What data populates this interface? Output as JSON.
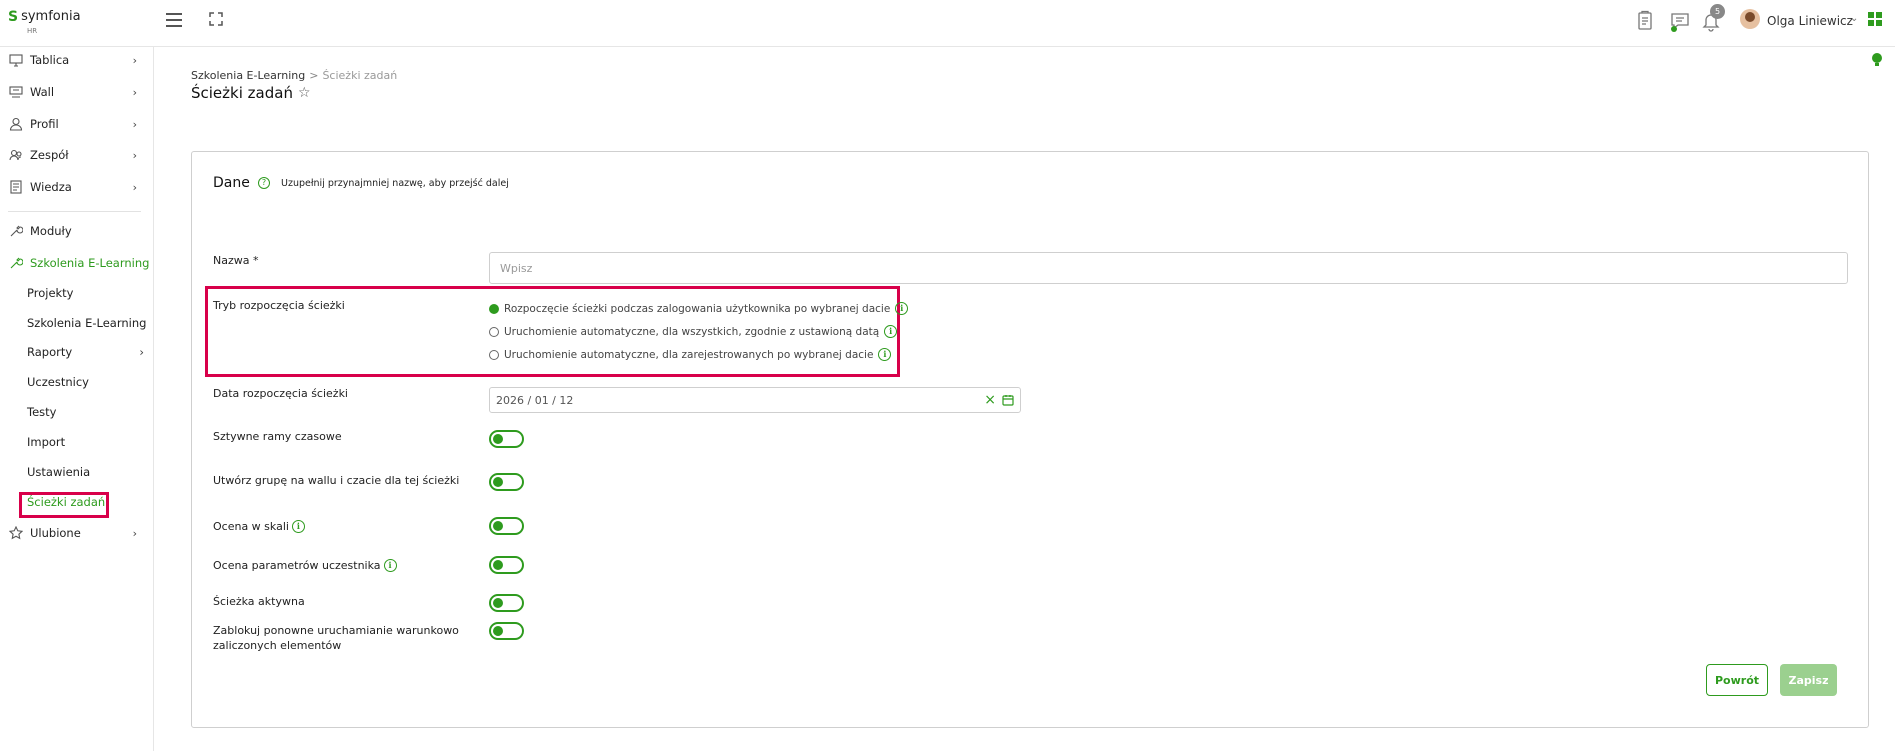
{
  "app": {
    "logo_text": "symfonia",
    "logo_sub": "HR",
    "notifications_count": "5",
    "user_name": "Olga Liniewicz"
  },
  "sidebar": {
    "items": [
      {
        "label": "Tablica",
        "icon": "monitor-icon"
      },
      {
        "label": "Wall",
        "icon": "wall-icon"
      },
      {
        "label": "Profil",
        "icon": "user-icon"
      },
      {
        "label": "Zespół",
        "icon": "team-icon"
      },
      {
        "label": "Wiedza",
        "icon": "book-icon"
      },
      {
        "label": "Moduły",
        "icon": "wrench-icon"
      },
      {
        "label": "Szkolenia E-Learning",
        "icon": "wrench-icon"
      }
    ],
    "sub_items": [
      "Projekty",
      "Szkolenia E-Learning",
      "Raporty",
      "Uczestnicy",
      "Testy",
      "Import",
      "Ustawienia",
      "Ścieżki zadań"
    ],
    "favorites": "Ulubione"
  },
  "header": {
    "breadcrumb_parent": "Szkolenia E-Learning",
    "breadcrumb_sep": ">",
    "breadcrumb_current": "Ścieżki zadań",
    "title": "Ścieżki zadań"
  },
  "form": {
    "section_title": "Dane",
    "hint": "Uzupełnij przynajmniej nazwę, aby przejść dalej",
    "name_label": "Nazwa *",
    "name_placeholder": "Wpisz",
    "mode_label": "Tryb rozpoczęcia ścieżki",
    "mode_options": [
      "Rozpoczęcie ścieżki podczas zalogowania użytkownika po wybranej dacie",
      "Uruchomienie automatyczne, dla wszystkich, zgodnie z ustawioną datą",
      "Uruchomienie automatyczne, dla zarejestrowanych po wybranej dacie"
    ],
    "mode_selected": 0,
    "start_date_label": "Data rozpoczęcia ścieżki",
    "start_date_value": "2026 / 01 / 12",
    "toggles": [
      {
        "label": "Sztywne ramy czasowe",
        "on": true
      },
      {
        "label": "Utwórz grupę na wallu i czacie dla tej ścieżki",
        "on": true
      },
      {
        "label": "Ocena w skali",
        "on": true
      },
      {
        "label": "Ocena parametrów uczestnika",
        "on": true
      },
      {
        "label": "Ścieżka aktywna",
        "on": true
      },
      {
        "label": "Zablokuj ponowne uruchamianie warunkowo zaliczonych elementów",
        "on": true
      }
    ],
    "back_button": "Powrót",
    "save_button": "Zapisz"
  },
  "colors": {
    "accent": "#2e9b1e",
    "highlight": "#d8004a"
  }
}
